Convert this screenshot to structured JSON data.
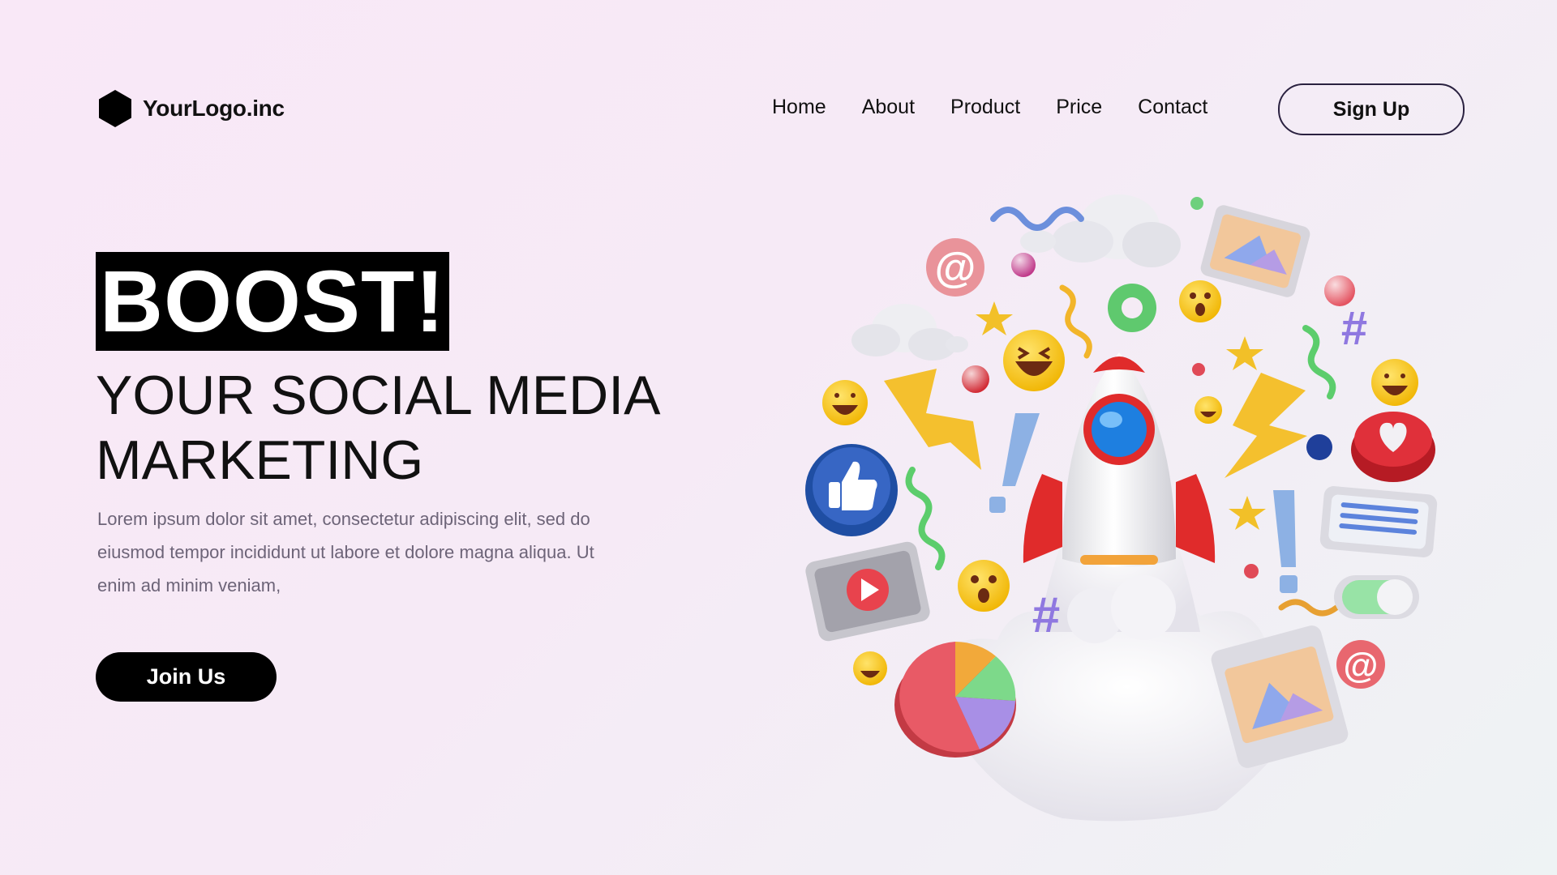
{
  "brand": {
    "logo_text": "YourLogo.inc",
    "logo_icon": "hexagon-logo-icon"
  },
  "nav": {
    "items": [
      {
        "label": "Home"
      },
      {
        "label": "About"
      },
      {
        "label": "Product"
      },
      {
        "label": "Price"
      },
      {
        "label": "Contact"
      }
    ],
    "signup_label": "Sign Up"
  },
  "hero": {
    "badge": "BOOST!",
    "headline_line1": "YOUR SOCIAL MEDIA",
    "headline_line2": "MARKETING",
    "paragraph": "Lorem ipsum dolor sit amet, consectetur adipiscing elit, sed do eiusmod tempor incididunt ut labore et dolore magna aliqua. Ut enim ad minim veniam,",
    "cta_label": "Join Us"
  },
  "illustration": {
    "icons": [
      "rocket-icon",
      "thumbs-up-icon",
      "heart-icon",
      "play-icon",
      "pie-chart-icon",
      "image-icon",
      "at-sign-icon",
      "hashtag-icon",
      "lightning-icon",
      "laughing-emoji-icon",
      "surprised-emoji-icon",
      "cloud-icon",
      "star-icon",
      "exclamation-icon",
      "toggle-icon",
      "message-icon"
    ]
  },
  "colors": {
    "background_start": "#f9e8f7",
    "background_end": "#eef3f4",
    "text": "#111111",
    "paragraph": "#6d6478",
    "button_dark": "#000000",
    "signup_border": "#2a2140",
    "rocket_red": "#e02b2b",
    "rocket_window": "#1e7fe0",
    "emoji_yellow": "#f6c718",
    "thumb_blue": "#1f4ea3"
  }
}
